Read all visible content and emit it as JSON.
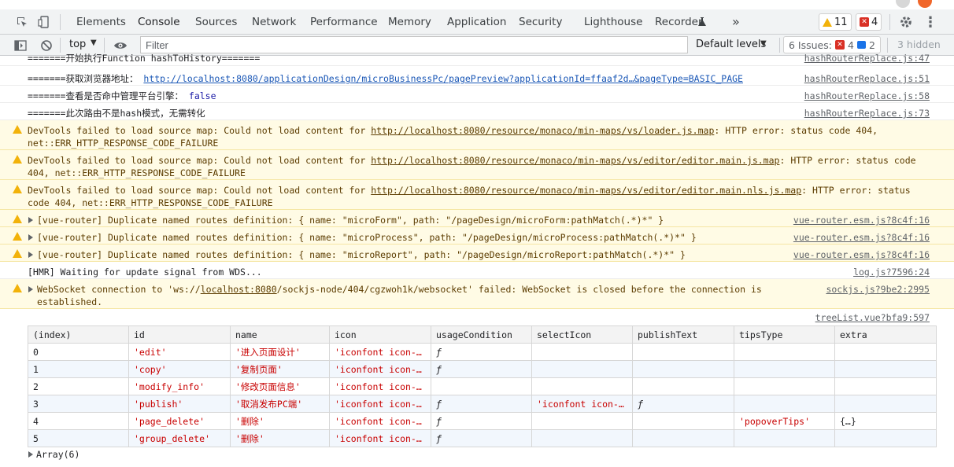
{
  "main_toolbar": {
    "tabs": [
      "Elements",
      "Console",
      "Sources",
      "Network",
      "Performance",
      "Memory",
      "Application",
      "Security",
      "Lighthouse",
      "Recorder"
    ],
    "active_tab": "Console",
    "more_tabs": "»",
    "warnings_count": "11",
    "errors_count": "4",
    "more_options": "⋮"
  },
  "console_toolbar": {
    "context": "top",
    "filter_placeholder": "Filter",
    "levels": "Default levels",
    "issues_label": "6 Issues:",
    "issues_err": "4",
    "issues_info": "2",
    "hidden": "3 hidden"
  },
  "messages": [
    {
      "text": "=======开始执行Function hashToHistory=======",
      "src": "hashRouterReplace.js:47"
    },
    {
      "text_a": "=======获取浏览器地址： ",
      "link": "http://localhost:8080/applicationDesign/microBusinessPc/pagePreview?applicationId=ffaaf2d…&pageType=BASIC_PAGE",
      "src": "hashRouterReplace.js:51"
    },
    {
      "text_a": "=======查看是否命中管理平台引擎： ",
      "bool": "false",
      "src": "hashRouterReplace.js:58"
    },
    {
      "text": "=======此次路由不是hash模式，无需转化",
      "src": "hashRouterReplace.js:73"
    },
    {
      "pre": "DevTools failed to load source map: Could not load content for ",
      "link": "http://localhost:8080/resource/monaco/min-maps/vs/loader.js.map",
      "post": ": HTTP error: status code 404, net::ERR_HTTP_RESPONSE_CODE_FAILURE"
    },
    {
      "pre": "DevTools failed to load source map: Could not load content for ",
      "link": "http://localhost:8080/resource/monaco/min-maps/vs/editor/editor.main.js.map",
      "post": ": HTTP error: status code 404, net::ERR_HTTP_RESPONSE_CODE_FAILURE"
    },
    {
      "pre": "DevTools failed to load source map: Could not load content for ",
      "link": "http://localhost:8080/resource/monaco/min-maps/vs/editor/editor.main.nls.js.map",
      "post": ": HTTP error: status code 404, net::ERR_HTTP_RESPONSE_CODE_FAILURE"
    },
    {
      "text": "[vue-router] Duplicate named routes definition: { name: \"microForm\", path: \"/pageDesign/microForm:pathMatch(.*)*\" }",
      "src": "vue-router.esm.js?8c4f:16"
    },
    {
      "text": "[vue-router] Duplicate named routes definition: { name: \"microProcess\", path: \"/pageDesign/microProcess:pathMatch(.*)*\" }",
      "src": "vue-router.esm.js?8c4f:16"
    },
    {
      "text": "[vue-router] Duplicate named routes definition: { name: \"microReport\", path: \"/pageDesign/microReport:pathMatch(.*)*\" }",
      "src": "vue-router.esm.js?8c4f:16"
    },
    {
      "text": "[HMR] Waiting for update signal from WDS...",
      "src": "log.js?7596:24"
    },
    {
      "pre": "WebSocket connection to 'ws://",
      "link": "localhost:8080",
      "post": "/sockjs-node/404/cgzwoh1k/websocket' failed: WebSocket is closed before the connection is established.",
      "src": "sockjs.js?9be2:2995"
    }
  ],
  "table": {
    "src": "treeList.vue?bfa9:597",
    "headers": [
      "(index)",
      "id",
      "name",
      "icon",
      "usageCondition",
      "selectIcon",
      "publishText",
      "tipsType",
      "extra"
    ],
    "rows": [
      [
        "0",
        "'edit'",
        "'进入页面设计'",
        "'iconfont icon-…",
        "ƒ",
        "",
        "",
        "",
        ""
      ],
      [
        "1",
        "'copy'",
        "'复制页面'",
        "'iconfont icon-…",
        "ƒ",
        "",
        "",
        "",
        ""
      ],
      [
        "2",
        "'modify_info'",
        "'修改页面信息'",
        "'iconfont icon-…",
        "",
        "",
        "",
        "",
        ""
      ],
      [
        "3",
        "'publish'",
        "'取消发布PC端'",
        "'iconfont icon-…",
        "ƒ",
        "'iconfont icon-…",
        "ƒ",
        "",
        ""
      ],
      [
        "4",
        "'page_delete'",
        "'删除'",
        "'iconfont icon-…",
        "ƒ",
        "",
        "",
        "'popoverTips'",
        "{…}"
      ],
      [
        "5",
        "'group_delete'",
        "'删除'",
        "'iconfont icon-…",
        "ƒ",
        "",
        "",
        "",
        ""
      ]
    ],
    "footer": "Array(6)"
  }
}
